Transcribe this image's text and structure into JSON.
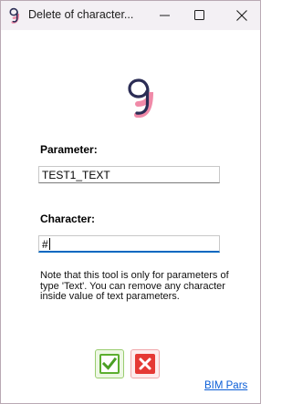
{
  "window": {
    "title": "Delete of character...",
    "app_icon": "bim-pars-logo-icon",
    "controls": [
      "minimize-icon",
      "maximize-icon",
      "close-icon"
    ]
  },
  "logo": {
    "icon": "bim-pars-logo-icon",
    "colors": {
      "dark": "#2b2d55",
      "pink": "#f08aa8"
    }
  },
  "form": {
    "parameter_label": "Parameter:",
    "parameter_value": "TEST1_TEXT",
    "character_label": "Character:",
    "character_value": "#"
  },
  "note": "Note that this tool is only for parameters of type 'Text'. You can remove any character inside value of text parameters.",
  "actions": {
    "ok_icon": "checkmark-icon",
    "cancel_icon": "x-icon",
    "ok_color": "#5cae2e",
    "cancel_color": "#e53935"
  },
  "footer": {
    "link_text": "BIM Pars"
  }
}
